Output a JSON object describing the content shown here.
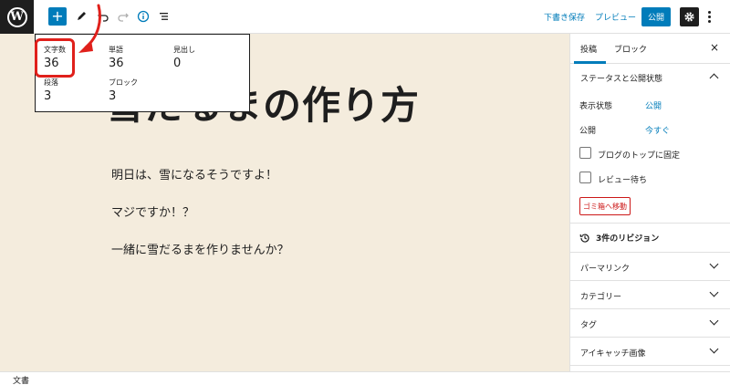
{
  "toolbar": {
    "save_draft": "下書き保存",
    "preview": "プレビュー",
    "publish": "公開"
  },
  "post": {
    "title": "雪だるまの作り方",
    "paragraphs": [
      "明日は、雪になるそうですよ！",
      "マジですか！？",
      "一緒に雪だるまを作りませんか？"
    ]
  },
  "info_panel": {
    "characters_label": "文字数",
    "characters_value": "36",
    "words_label": "単語",
    "words_value": "36",
    "headings_label": "見出し",
    "headings_value": "0",
    "paragraphs_label": "段落",
    "paragraphs_value": "3",
    "blocks_label": "ブロック",
    "blocks_value": "3"
  },
  "sidebar": {
    "tab_post": "投稿",
    "tab_block": "ブロック",
    "close": "×",
    "status_title": "ステータスと公開状態",
    "visibility_label": "表示状態",
    "visibility_value": "公開",
    "publish_label": "公開",
    "publish_value": "今すぐ",
    "sticky_label": "ブログのトップに固定",
    "pending_label": "レビュー待ち",
    "trash_label": "ゴミ箱へ移動",
    "revisions": "3件のリビジョン",
    "permalink": "パーマリンク",
    "categories": "カテゴリー",
    "tags": "タグ",
    "featured_image": "アイキャッチ画像"
  },
  "footer": {
    "breadcrumb": "文書"
  },
  "colors": {
    "accent": "#007cba",
    "highlight": "#e0201b",
    "canvas": "#f4ecdd"
  }
}
